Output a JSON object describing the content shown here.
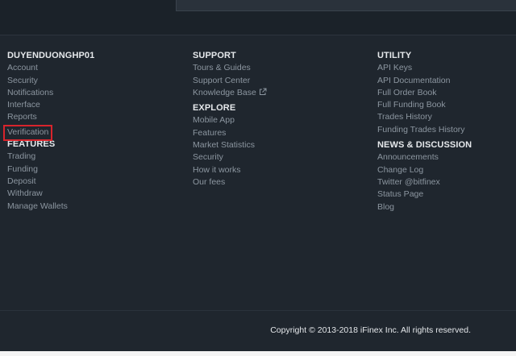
{
  "footer": {
    "account_column": {
      "heading": "DUYENDUONGHP01",
      "links": [
        "Account",
        "Security",
        "Notifications",
        "Interface",
        "Reports",
        "Verification"
      ],
      "features_heading": "FEATURES",
      "features_links": [
        "Trading",
        "Funding",
        "Deposit",
        "Withdraw",
        "Manage Wallets"
      ]
    },
    "support_column": {
      "heading": "SUPPORT",
      "links": [
        "Tours & Guides",
        "Support Center",
        "Knowledge Base"
      ],
      "knowledge_base_icon": "external-link-icon",
      "explore_heading": "EXPLORE",
      "explore_links": [
        "Mobile App",
        "Features",
        "Market Statistics",
        "Security",
        "How it works",
        "Our fees"
      ]
    },
    "utility_column": {
      "heading": "UTILITY",
      "links": [
        "API Keys",
        "API Documentation",
        "Full Order Book",
        "Full Funding Book",
        "Trades History",
        "Funding Trades History"
      ],
      "news_heading": "NEWS & DISCUSSION",
      "news_links": [
        "Announcements",
        "Change Log",
        "Twitter @bitfinex",
        "Status Page",
        "Blog"
      ]
    },
    "copyright": "Copyright © 2013-2018 iFinex Inc.  All rights reserved."
  },
  "colors": {
    "background": "#1f262e",
    "heading": "#e6e9ec",
    "link": "#8c96a0",
    "highlight_box": "#d8242c"
  }
}
